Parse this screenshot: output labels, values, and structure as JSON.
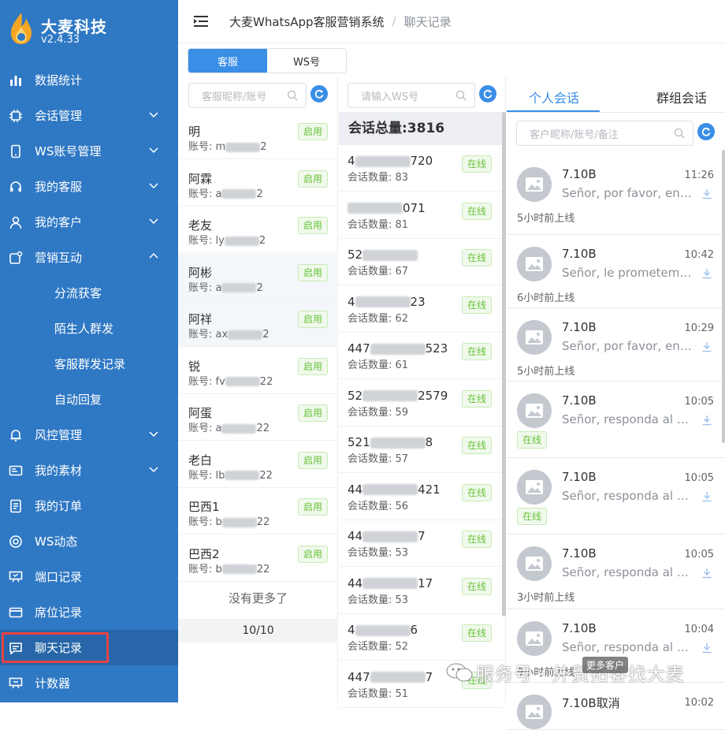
{
  "brand": {
    "title": "大麦科技",
    "version": "v2.4.33"
  },
  "menu": [
    {
      "label": "数据统计",
      "icon": "bar-chart-icon",
      "expand": ""
    },
    {
      "label": "会话管理",
      "icon": "chip-icon",
      "expand": "down"
    },
    {
      "label": "WS账号管理",
      "icon": "phone-icon",
      "expand": "down"
    },
    {
      "label": "我的客服",
      "icon": "headset-icon",
      "expand": "down"
    },
    {
      "label": "我的客户",
      "icon": "user-icon",
      "expand": "down"
    },
    {
      "label": "营销互动",
      "icon": "share-icon",
      "expand": "up"
    },
    {
      "label": "分流获客",
      "sub": true
    },
    {
      "label": "陌生人群发",
      "sub": true
    },
    {
      "label": "客服群发记录",
      "sub": true
    },
    {
      "label": "自动回复",
      "sub": true
    },
    {
      "label": "风控管理",
      "icon": "bell-icon",
      "expand": "down"
    },
    {
      "label": "我的素材",
      "icon": "id-card-icon",
      "expand": "down"
    },
    {
      "label": "我的订单",
      "icon": "document-icon",
      "expand": ""
    },
    {
      "label": "WS动态",
      "icon": "lifebuoy-icon",
      "expand": ""
    },
    {
      "label": "端口记录",
      "icon": "presentation-icon",
      "expand": ""
    },
    {
      "label": "席位记录",
      "icon": "credit-card-icon",
      "expand": ""
    },
    {
      "label": "聊天记录",
      "icon": "chat-icon",
      "expand": "",
      "active": true
    },
    {
      "label": "计数器",
      "icon": "counter-icon",
      "expand": ""
    }
  ],
  "header": {
    "system": "大麦WhatsApp客服营销系统",
    "separator": "/",
    "page": "聊天记录"
  },
  "tabs": {
    "agent": "客服",
    "ws": "WS号"
  },
  "agents_search": {
    "placeholder": "客服昵称/账号"
  },
  "agents": [
    {
      "name": "明",
      "acct_prefix": "账号: m",
      "acct_suffix": "2",
      "status": "启用"
    },
    {
      "name": "阿霖",
      "acct_prefix": "账号: a",
      "acct_suffix": "2",
      "status": "启用"
    },
    {
      "name": "老友",
      "acct_prefix": "账号: ly",
      "acct_suffix": "2",
      "status": "启用"
    },
    {
      "name": "阿彬",
      "acct_prefix": "账号: a",
      "acct_suffix": "2",
      "status": "启用"
    },
    {
      "name": "阿祥",
      "acct_prefix": "账号: ax",
      "acct_suffix": "2",
      "status": "启用"
    },
    {
      "name": "锐",
      "acct_prefix": "账号: fv",
      "acct_suffix": "22",
      "status": "启用"
    },
    {
      "name": "阿蛋",
      "acct_prefix": "账号: a",
      "acct_suffix": "22",
      "status": "启用"
    },
    {
      "name": "老白",
      "acct_prefix": "账号: lb",
      "acct_suffix": "22",
      "status": "启用"
    },
    {
      "name": "巴西1",
      "acct_prefix": "账号: b",
      "acct_suffix": "22",
      "status": "启用"
    },
    {
      "name": "巴西2",
      "acct_prefix": "账号: b",
      "acct_suffix": "22",
      "status": "启用"
    }
  ],
  "agents_footer": {
    "no_more": "没有更多了",
    "page": "10/10"
  },
  "ws_search": {
    "placeholder": "请输入WS号"
  },
  "ws_total": "会话总量:3816",
  "ws_list": [
    {
      "prefix": "4",
      "suffix": "720",
      "count": "会话数量: 83",
      "status": "在线"
    },
    {
      "prefix": "",
      "suffix": "071",
      "count": "会话数量: 81",
      "status": "在线"
    },
    {
      "prefix": "52",
      "suffix": "",
      "count": "会话数量: 67",
      "status": "在线"
    },
    {
      "prefix": "4",
      "suffix": "23",
      "count": "会话数量: 62",
      "status": "在线"
    },
    {
      "prefix": "447",
      "suffix": "523",
      "count": "会话数量: 61",
      "status": "在线"
    },
    {
      "prefix": "52",
      "suffix": "2579",
      "count": "会话数量: 59",
      "status": "在线"
    },
    {
      "prefix": "521",
      "suffix": "8",
      "count": "会话数量: 57",
      "status": "在线"
    },
    {
      "prefix": "44",
      "suffix": "421",
      "count": "会话数量: 56",
      "status": "在线"
    },
    {
      "prefix": "44",
      "suffix": "7",
      "count": "会话数量: 53",
      "status": "在线"
    },
    {
      "prefix": "44",
      "suffix": "17",
      "count": "会话数量: 53",
      "status": "在线"
    },
    {
      "prefix": "4",
      "suffix": "6",
      "count": "会话数量: 52",
      "status": "在线"
    },
    {
      "prefix": "447",
      "suffix": "7",
      "count": "会话数量: 51",
      "status": "在线"
    }
  ],
  "chat_tabs": {
    "personal": "个人会话",
    "group": "群组会话"
  },
  "chat_search": {
    "placeholder": "客户昵称/账号/备注"
  },
  "chats": [
    {
      "name": "7.10B",
      "time": "11:26",
      "msg": "Señor, por favor, enví...",
      "status": "5小时前上线",
      "online": false
    },
    {
      "name": "7.10B",
      "time": "10:42",
      "msg": "Señor, le prometemo...",
      "status": "6小时前上线",
      "online": false
    },
    {
      "name": "7.10B",
      "time": "10:29",
      "msg": "Señor, por favor, enví...",
      "status": "5小时前上线",
      "online": false
    },
    {
      "name": "7.10B",
      "time": "10:05",
      "msg": "Señor, responda al m...",
      "status": "在线",
      "online": true
    },
    {
      "name": "7.10B",
      "time": "10:05",
      "msg": "Señor, responda al m...",
      "status": "在线",
      "online": true
    },
    {
      "name": "7.10B",
      "time": "10:05",
      "msg": "Señor, responda al m...",
      "status": "3小时前上线",
      "online": false
    },
    {
      "name": "7.10B",
      "time": "10:04",
      "msg": "Señor, responda al m...",
      "status": "9小时前上线",
      "online": false
    },
    {
      "name": "7.10B取消",
      "time": "10:02",
      "msg": "",
      "status": "",
      "online": false
    }
  ],
  "watermark": {
    "text": "服务号 · 外贸拓客找大麦",
    "badge": "更多客户"
  },
  "colors": {
    "sidebar": "#2f78c4",
    "accent": "#3a8ee6",
    "online_green": "#67c23a",
    "highlight_red": "#e84343"
  }
}
